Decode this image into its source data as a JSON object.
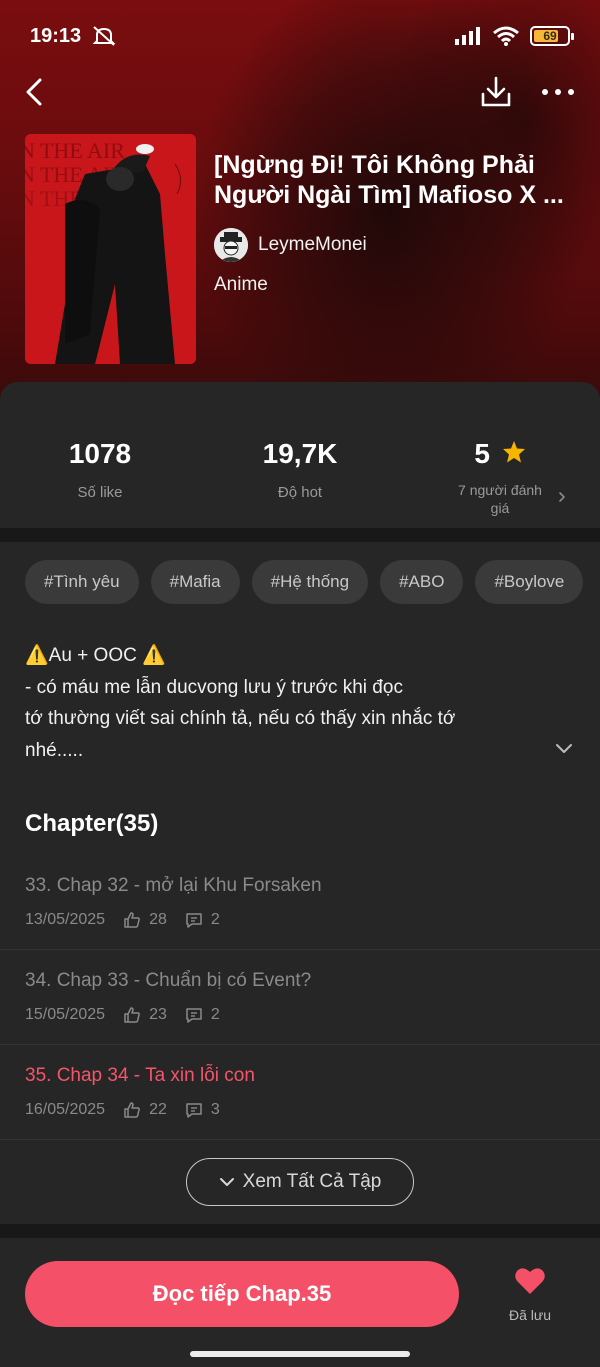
{
  "status_bar": {
    "time": "19:13",
    "battery": "69",
    "battery_color": "#f5b73a"
  },
  "nav": {
    "back_icon": "chevron-left-icon",
    "download_icon": "download-icon",
    "more_icon": "more-horizontal-icon"
  },
  "story": {
    "title_line1": "[Ngừng Đi! Tôi Không Phải",
    "title_line2": "Người Ngài Tìm] Mafioso X ...",
    "author": "LeymeMonei",
    "genre": "Anime",
    "cover_text": "N THE AIR"
  },
  "stats": {
    "likes_value": "1078",
    "likes_label": "Số like",
    "hot_value": "19,7K",
    "hot_label": "Độ hot",
    "rating_value": "5",
    "rating_label": "7 người đánh giá"
  },
  "tags": [
    "#Tình yêu",
    "#Mafia",
    "#Hệ thống",
    "#ABO",
    "#Boylove"
  ],
  "description": {
    "line1": "⚠️Au + OOC ⚠️",
    "line2": "- có máu me lẫn ducvong lưu ý trước khi đọc",
    "line3": "tớ thường viết sai chính tả, nếu có thấy xin nhắc tớ",
    "line4": "nhé....."
  },
  "chapters": {
    "heading": "Chapter(35)",
    "items": [
      {
        "title": "33. Chap 32 - mở lại Khu Forsaken",
        "date": "13/05/2025",
        "likes": "28",
        "comments": "2"
      },
      {
        "title": "34. Chap 33 - Chuẩn bị có Event?",
        "date": "15/05/2025",
        "likes": "23",
        "comments": "2"
      },
      {
        "title": "35. Chap 34 - Ta xin lỗi con",
        "date": "16/05/2025",
        "likes": "22",
        "comments": "3"
      }
    ],
    "see_all": "Xem Tất Cả Tập"
  },
  "bottom": {
    "read_button": "Đọc tiếp Chap.35",
    "saved_label": "Đã lưu",
    "accent_color": "#f45068"
  }
}
